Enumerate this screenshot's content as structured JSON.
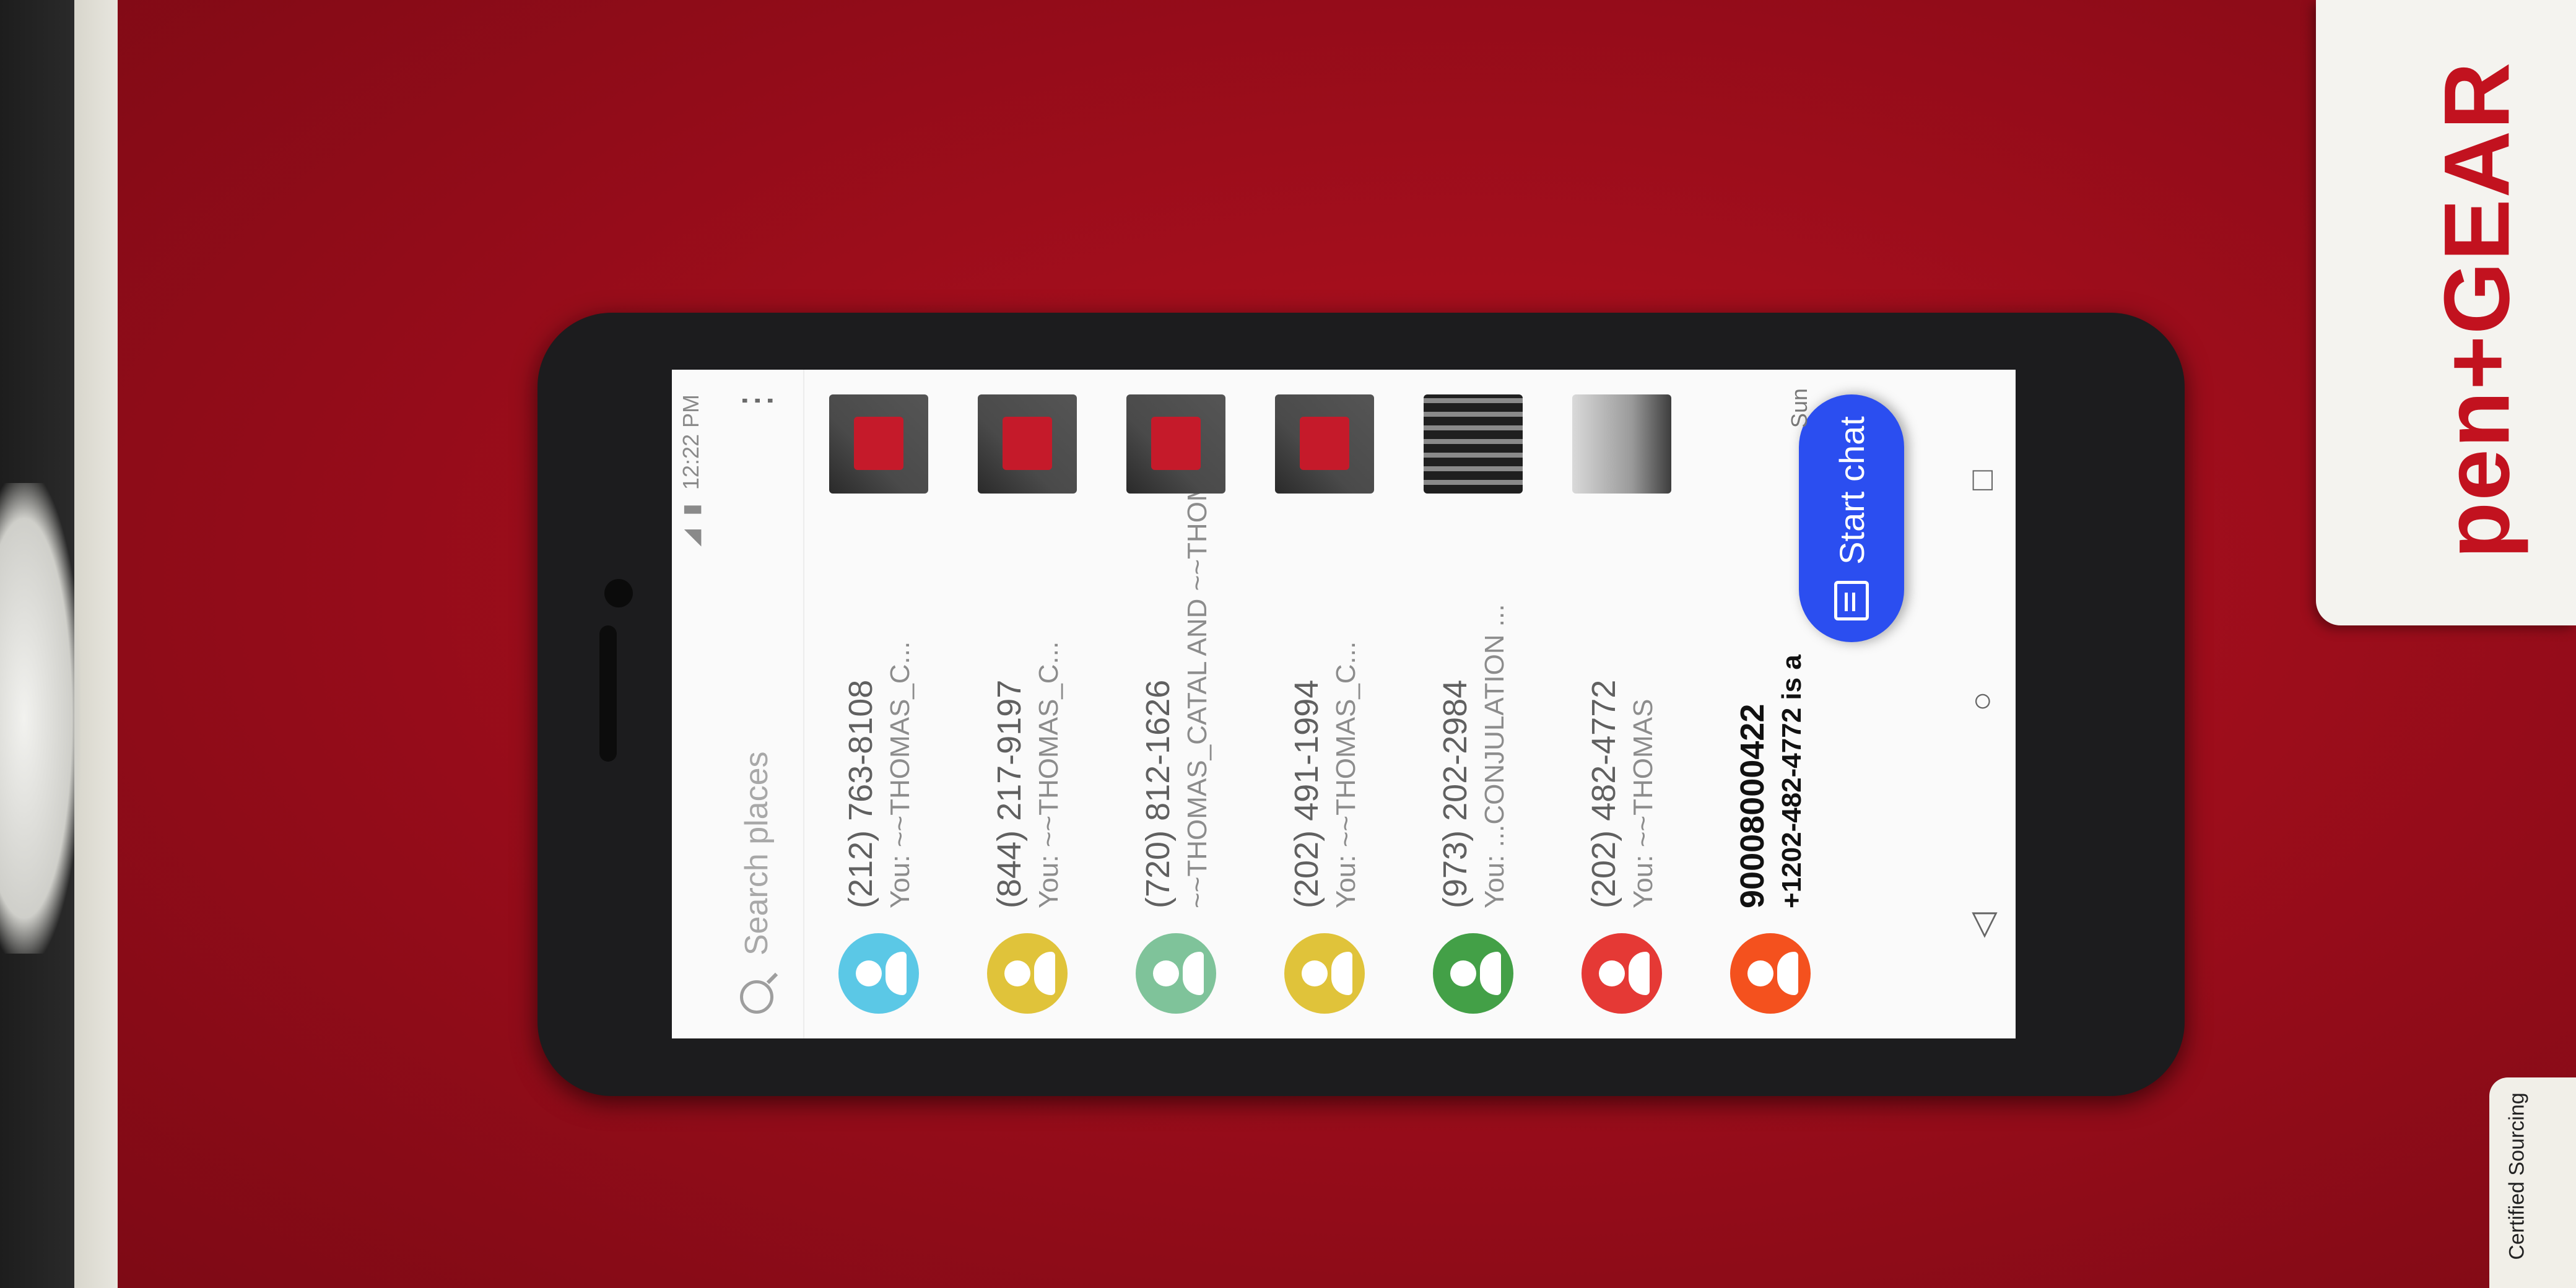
{
  "label": {
    "brand": "pen+GEAR",
    "certified": "Certified Sourcing"
  },
  "status_bar": {
    "time": "12:22 PM"
  },
  "search": {
    "placeholder": "Search places"
  },
  "menu_icon": "⋮",
  "conversations": [
    {
      "title": "(212) 763-8108",
      "snippet": "You: ~~THOMAS_C...",
      "avatar_color": "#5bc8e6",
      "thumb": "red-photo",
      "bold": false
    },
    {
      "title": "(844) 217-9197",
      "snippet": "You: ~~THOMAS_C...",
      "avatar_color": "#e0c33a",
      "thumb": "red-photo",
      "bold": false
    },
    {
      "title": "(720) 812-1626",
      "snippet": "~~THOMAS_CATAL AND ~~THOMAS_CATALA...",
      "avatar_color": "#7fc39a",
      "thumb": "red-photo",
      "bold": false
    },
    {
      "title": "(202) 491-1994",
      "snippet": "You: ~~THOMAS_C...",
      "avatar_color": "#e0c33a",
      "thumb": "red-photo",
      "bold": false
    },
    {
      "title": "(973) 202-2984",
      "snippet": "You: ...CONJULATION ...",
      "avatar_color": "#43a047",
      "thumb": "dark-photo",
      "bold": false
    },
    {
      "title": "(202) 482-4772",
      "snippet": "You: ~~THOMAS",
      "avatar_color": "#e53935",
      "thumb": "bright-photo",
      "bold": false
    },
    {
      "title": "90008000422",
      "snippet": "+1202-482-4772 is a",
      "avatar_color": "#f4511e",
      "thumb": "",
      "bold": true
    }
  ],
  "fab": {
    "label": "Start chat"
  },
  "last_time": "Sun",
  "nav": {
    "back": "◁",
    "home": "○",
    "recents": "□"
  }
}
